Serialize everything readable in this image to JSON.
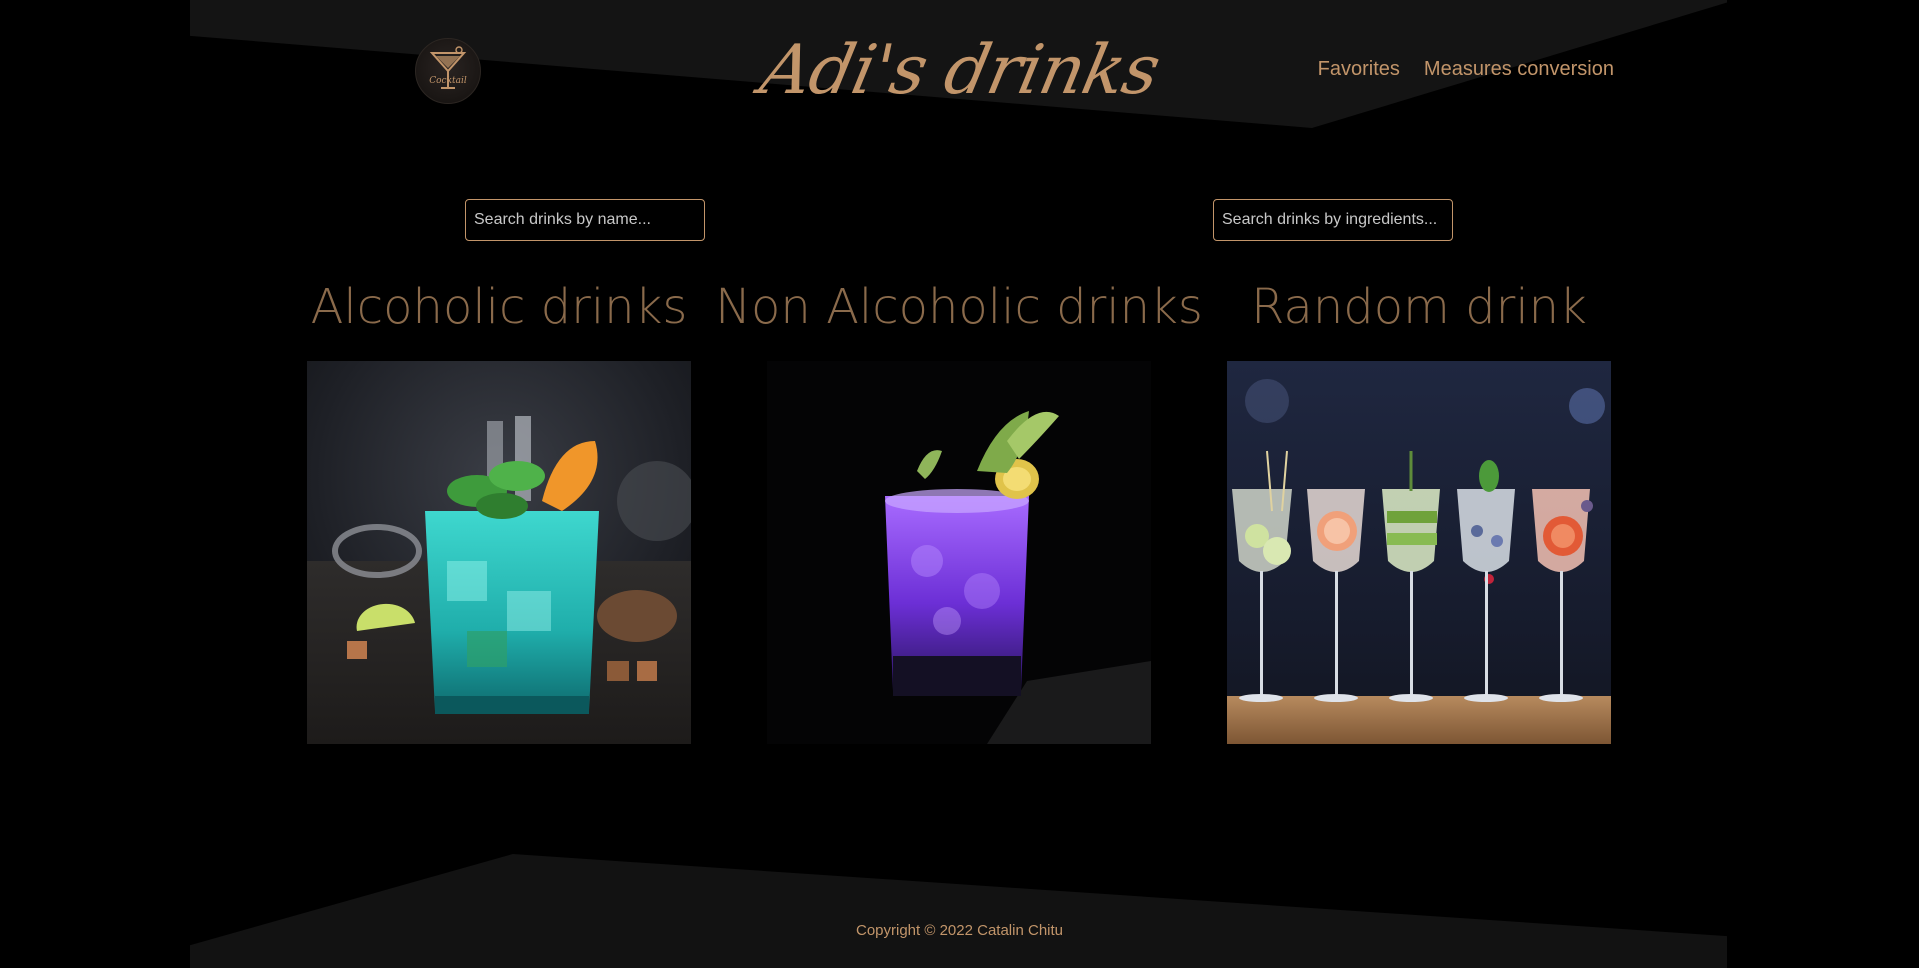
{
  "header": {
    "site_title": "Adi's drinks",
    "logo_icon": "cocktail-logo-icon",
    "nav": [
      {
        "label": "Favorites"
      },
      {
        "label": "Measures conversion"
      }
    ]
  },
  "search": {
    "by_name_placeholder": "Search drinks by name...",
    "by_ingredients_placeholder": "Search drinks by ingredients..."
  },
  "categories": [
    {
      "title": "Alcoholic drinks",
      "image": "blue-mint-cocktail-image"
    },
    {
      "title": "Non Alcoholic drinks",
      "image": "purple-cocktail-image"
    },
    {
      "title": "Random drink",
      "image": "row-of-gin-tonic-glasses-image"
    }
  ],
  "footer": {
    "copyright": "Copyright © 2022 Catalin Chitu"
  },
  "colors": {
    "accent": "#c2956a",
    "title_muted": "#8a6a4b",
    "background": "#000000",
    "band": "#141414"
  }
}
